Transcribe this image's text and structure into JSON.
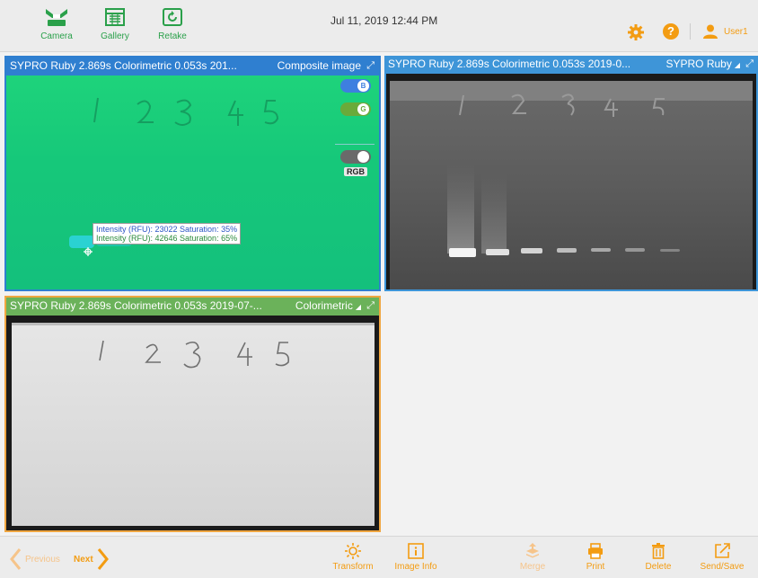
{
  "toolbar": {
    "camera_label": "Camera",
    "gallery_label": "Gallery",
    "retake_label": "Retake",
    "datetime": "Jul 11, 2019  12:44 PM",
    "user_label": "User1",
    "accent_color": "#2aa04a",
    "orange_color": "#f39c12"
  },
  "panels": [
    {
      "title": "SYPRO Ruby 2.869s Colorimetric 0.053s 201...",
      "mode": "Composite image",
      "channels": {
        "b_label": "B",
        "g_label": "G",
        "rgb_label": "RGB"
      },
      "tooltip": {
        "line1": "Intensity (RFU): 23022 Saturation:  35%",
        "line2": "Intensity (RFU): 42646 Saturation:  65%"
      },
      "lane_marks": "1  2  3  4  5"
    },
    {
      "title": "SYPRO Ruby 2.869s Colorimetric 0.053s 2019-0...",
      "mode": "SYPRO Ruby"
    },
    {
      "title": "SYPRO Ruby 2.869s Colorimetric 0.053s 2019-07-...",
      "mode": "Colorimetric",
      "lane_marks": "1  2  3  4  5"
    }
  ],
  "bottom": {
    "previous_label": "Previous",
    "next_label": "Next",
    "transform_label": "Transform",
    "image_info_label": "Image Info",
    "merge_label": "Merge",
    "print_label": "Print",
    "delete_label": "Delete",
    "send_save_label": "Send/Save"
  }
}
